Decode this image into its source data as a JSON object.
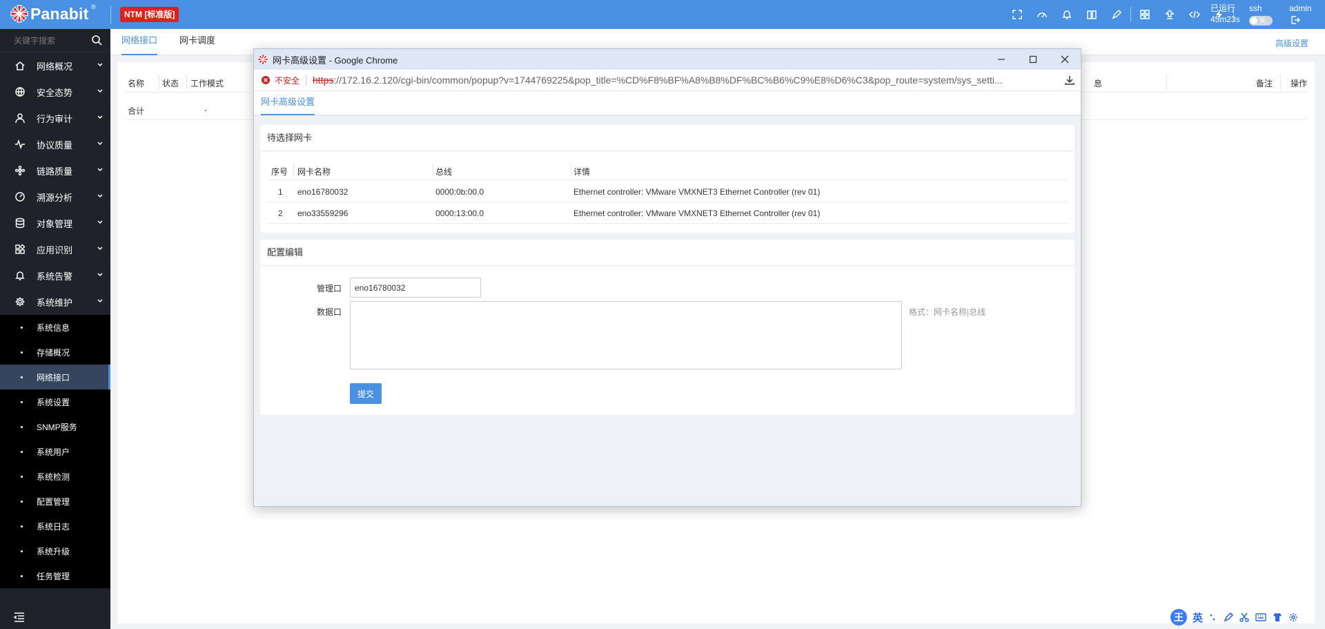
{
  "topbar": {
    "logo": "Panabit",
    "logo_mark": "®",
    "edition": "NTM [标准版]",
    "icons": [
      "fullscreen-icon",
      "dashboard-icon",
      "bell-icon",
      "book-icon",
      "pen-icon",
      "widgets-icon",
      "upgrade-icon",
      "code-icon",
      "lightning-icon"
    ],
    "run_label": "已运行",
    "run_time": "45m23s",
    "ssh_label": "ssh",
    "ssh_toggle": "关",
    "admin_label": "admin"
  },
  "sidebar": {
    "search_placeholder": "关键字搜索",
    "items": [
      {
        "label": "网络概况",
        "icon": "house-icon"
      },
      {
        "label": "安全态势",
        "icon": "globe-icon"
      },
      {
        "label": "行为审计",
        "icon": "user-icon"
      },
      {
        "label": "协议质量",
        "icon": "pulse-icon"
      },
      {
        "label": "链路质量",
        "icon": "fan-icon"
      },
      {
        "label": "溯源分析",
        "icon": "gauge-icon"
      },
      {
        "label": "对象管理",
        "icon": "database-icon"
      },
      {
        "label": "应用识别",
        "icon": "apps-icon"
      },
      {
        "label": "系统告警",
        "icon": "bell-icon"
      },
      {
        "label": "系统维护",
        "icon": "gear-icon"
      }
    ],
    "sub_items": [
      "系统信息",
      "存储概况",
      "网络接口",
      "系统设置",
      "SNMP服务",
      "系统用户",
      "系统检测",
      "配置管理",
      "系统日志",
      "系统升级",
      "任务管理"
    ],
    "active_sub": "网络接口"
  },
  "tabs": {
    "items": [
      "网络接口",
      "网卡调度"
    ],
    "active": "网络接口",
    "advanced_link": "高级设置"
  },
  "main_table": {
    "headers": [
      "名称",
      "状态",
      "工作模式",
      "息",
      "备注",
      "操作"
    ],
    "total_row": {
      "name": "合计",
      "status": "-"
    }
  },
  "popup": {
    "window_title": "网卡高级设置 - Google Chrome",
    "security_label": "不安全",
    "url_scheme": "https",
    "url_rest": "://172.16.2.120/cgi-bin/common/popup?v=1744769225&pop_title=%CD%F8%BF%A8%B8%DF%BC%B6%C9%E8%D6%C3&pop_route=system/sys_setti...",
    "tab": "网卡高级设置",
    "nic_section": {
      "title": "待选择网卡",
      "headers": [
        "序号",
        "网卡名称",
        "总线",
        "详情"
      ],
      "rows": [
        {
          "no": "1",
          "name": "eno16780032",
          "bus": "0000:0b:00.0",
          "detail": "Ethernet controller: VMware VMXNET3 Ethernet Controller (rev 01)"
        },
        {
          "no": "2",
          "name": "eno33559296",
          "bus": "0000:13:00.0",
          "detail": "Ethernet controller: VMware VMXNET3 Ethernet Controller (rev 01)"
        }
      ]
    },
    "config_section": {
      "title": "配置编辑",
      "mgmt_label": "管理口",
      "mgmt_value": "eno16780032",
      "data_label": "数据口",
      "data_value": "",
      "data_hint": "格式：网卡名称|总线",
      "submit_label": "提交"
    }
  },
  "ime": {
    "label": "英",
    "logo": "王"
  },
  "colors": {
    "brand": "#4a90e2",
    "sidebar": "#1f2229",
    "edition_badge": "#e02020",
    "insecure": "#c5221f"
  }
}
